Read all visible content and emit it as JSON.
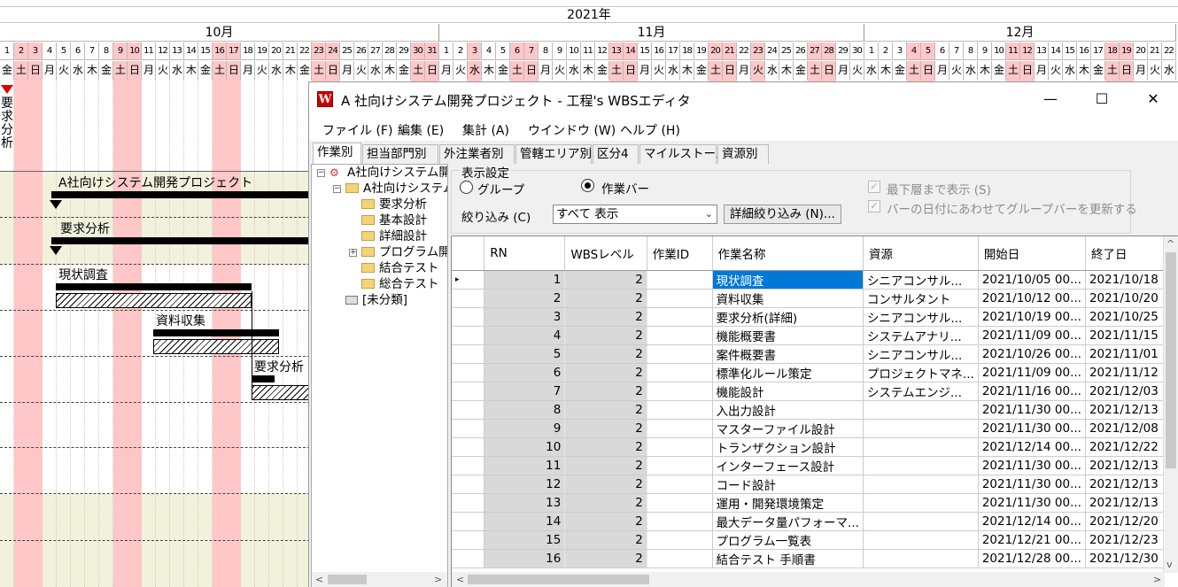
{
  "gantt": {
    "year": "2021年",
    "months": [
      {
        "label": "10月",
        "start": 0,
        "days": 31
      },
      {
        "label": "11月",
        "start": 31,
        "days": 30
      },
      {
        "label": "12月",
        "start": 61,
        "days": 22
      }
    ],
    "start_weekday_index": 0,
    "weekdays": [
      "金",
      "土",
      "日",
      "月",
      "火",
      "水",
      "木"
    ],
    "holidays": [
      "10-2",
      "10-3",
      "10-9",
      "10-10",
      "10-16",
      "10-17",
      "10-23",
      "10-24",
      "10-30",
      "10-31",
      "11-3",
      "11-6",
      "11-7",
      "11-13",
      "11-14",
      "11-20",
      "11-21",
      "11-23",
      "11-27",
      "11-28",
      "12-4",
      "12-5",
      "12-11",
      "12-12",
      "12-18",
      "12-19"
    ],
    "side_label": "要求分析",
    "bars": [
      {
        "label": "A社向けシステム開発プロジェクト"
      },
      {
        "label": "要求分析"
      },
      {
        "label": "現状調査"
      },
      {
        "label": "資料収集"
      },
      {
        "label": "要求分析"
      }
    ]
  },
  "window": {
    "icon": "W",
    "title": "A 社向けシステム開発プロジェクト - 工程's WBSエディタ",
    "controls": {
      "minimize": "—",
      "maximize": "☐",
      "close": "✕"
    },
    "menu": [
      "ファイル (F)",
      "編集 (E)",
      "集計 (A)",
      "ウインドウ (W)",
      "ヘルプ (H)"
    ],
    "tabs": [
      "作業別",
      "担当部門別",
      "外注業者別",
      "管轄エリア別",
      "区分4",
      "マイルストーン",
      "資源別"
    ],
    "active_tab": 0
  },
  "tree": {
    "root": "A社向けシステム開",
    "project": "A社向けシステム",
    "children": [
      "要求分析",
      "基本設計",
      "詳細設計",
      "プログラム開",
      "結合テスト",
      "総合テスト"
    ],
    "unclassified": "[未分類]"
  },
  "settings": {
    "title": "表示設定",
    "radio_group": "グループ",
    "radio_bar": "作業バー",
    "radio_selected": "作業バー",
    "filter_label": "絞り込み (C)",
    "filter_value": "すべて 表示",
    "detail_filter_button": "詳細絞り込み (N)...",
    "check_lowest": "最下層まで表示 (S)",
    "check_update": "バーの日付にあわせてグループバーを更新する",
    "check_lowest_checked": true,
    "check_update_checked": true
  },
  "grid": {
    "columns": [
      "RN",
      "WBSレベル",
      "作業ID",
      "作業名称",
      "資源",
      "開始日",
      "終了日"
    ],
    "rows": [
      {
        "rn": "1",
        "level": "2",
        "id": "",
        "name": "現状調査",
        "resource": "シニアコンサル...",
        "start": "2021/10/05 00...",
        "end": "2021/10/18 ..."
      },
      {
        "rn": "2",
        "level": "2",
        "id": "",
        "name": "資料収集",
        "resource": "コンサルタント",
        "start": "2021/10/12 00...",
        "end": "2021/10/20 ..."
      },
      {
        "rn": "3",
        "level": "2",
        "id": "",
        "name": "要求分析(詳細)",
        "resource": "シニアコンサル...",
        "start": "2021/10/19 00...",
        "end": "2021/10/25 ..."
      },
      {
        "rn": "4",
        "level": "2",
        "id": "",
        "name": "機能概要書",
        "resource": "システムアナリ...",
        "start": "2021/11/09 00...",
        "end": "2021/11/15 ..."
      },
      {
        "rn": "5",
        "level": "2",
        "id": "",
        "name": "案件概要書",
        "resource": "シニアコンサル...",
        "start": "2021/10/26 00...",
        "end": "2021/11/01 ..."
      },
      {
        "rn": "6",
        "level": "2",
        "id": "",
        "name": "標準化ルール策定",
        "resource": "プロジェクトマネ...",
        "start": "2021/11/09 00...",
        "end": "2021/11/12 ..."
      },
      {
        "rn": "7",
        "level": "2",
        "id": "",
        "name": "機能設計",
        "resource": "システムエンジ...",
        "start": "2021/11/16 00...",
        "end": "2021/12/03 ..."
      },
      {
        "rn": "8",
        "level": "2",
        "id": "",
        "name": "入出力設計",
        "resource": "",
        "start": "2021/11/30 00...",
        "end": "2021/12/13 ..."
      },
      {
        "rn": "9",
        "level": "2",
        "id": "",
        "name": "マスターファイル設計",
        "resource": "",
        "start": "2021/11/30 00...",
        "end": "2021/12/08 ..."
      },
      {
        "rn": "10",
        "level": "2",
        "id": "",
        "name": "トランザクション設計",
        "resource": "",
        "start": "2021/12/14 00...",
        "end": "2021/12/22 ..."
      },
      {
        "rn": "11",
        "level": "2",
        "id": "",
        "name": "インターフェース設計",
        "resource": "",
        "start": "2021/11/30 00...",
        "end": "2021/12/13 ..."
      },
      {
        "rn": "12",
        "level": "2",
        "id": "",
        "name": "コード設計",
        "resource": "",
        "start": "2021/11/30 00...",
        "end": "2021/12/13 ..."
      },
      {
        "rn": "13",
        "level": "2",
        "id": "",
        "name": "運用・開発環境策定",
        "resource": "",
        "start": "2021/11/30 00...",
        "end": "2021/12/13 ..."
      },
      {
        "rn": "14",
        "level": "2",
        "id": "",
        "name": "最大データ量パフォーマ...",
        "resource": "",
        "start": "2021/12/14 00...",
        "end": "2021/12/20 ..."
      },
      {
        "rn": "15",
        "level": "2",
        "id": "",
        "name": "プログラム一覧表",
        "resource": "",
        "start": "2021/12/21 00...",
        "end": "2021/12/23 ..."
      },
      {
        "rn": "16",
        "level": "2",
        "id": "",
        "name": "結合テスト 手順書",
        "resource": "",
        "start": "2021/12/28 00...",
        "end": "2021/12/30 ..."
      }
    ],
    "selected_row": 0,
    "selected_col": "name",
    "row_marker": "▸"
  },
  "colors": {
    "holiday": "#ffc7c7",
    "band": "#f2f1dc",
    "selection": "#0078d7"
  }
}
